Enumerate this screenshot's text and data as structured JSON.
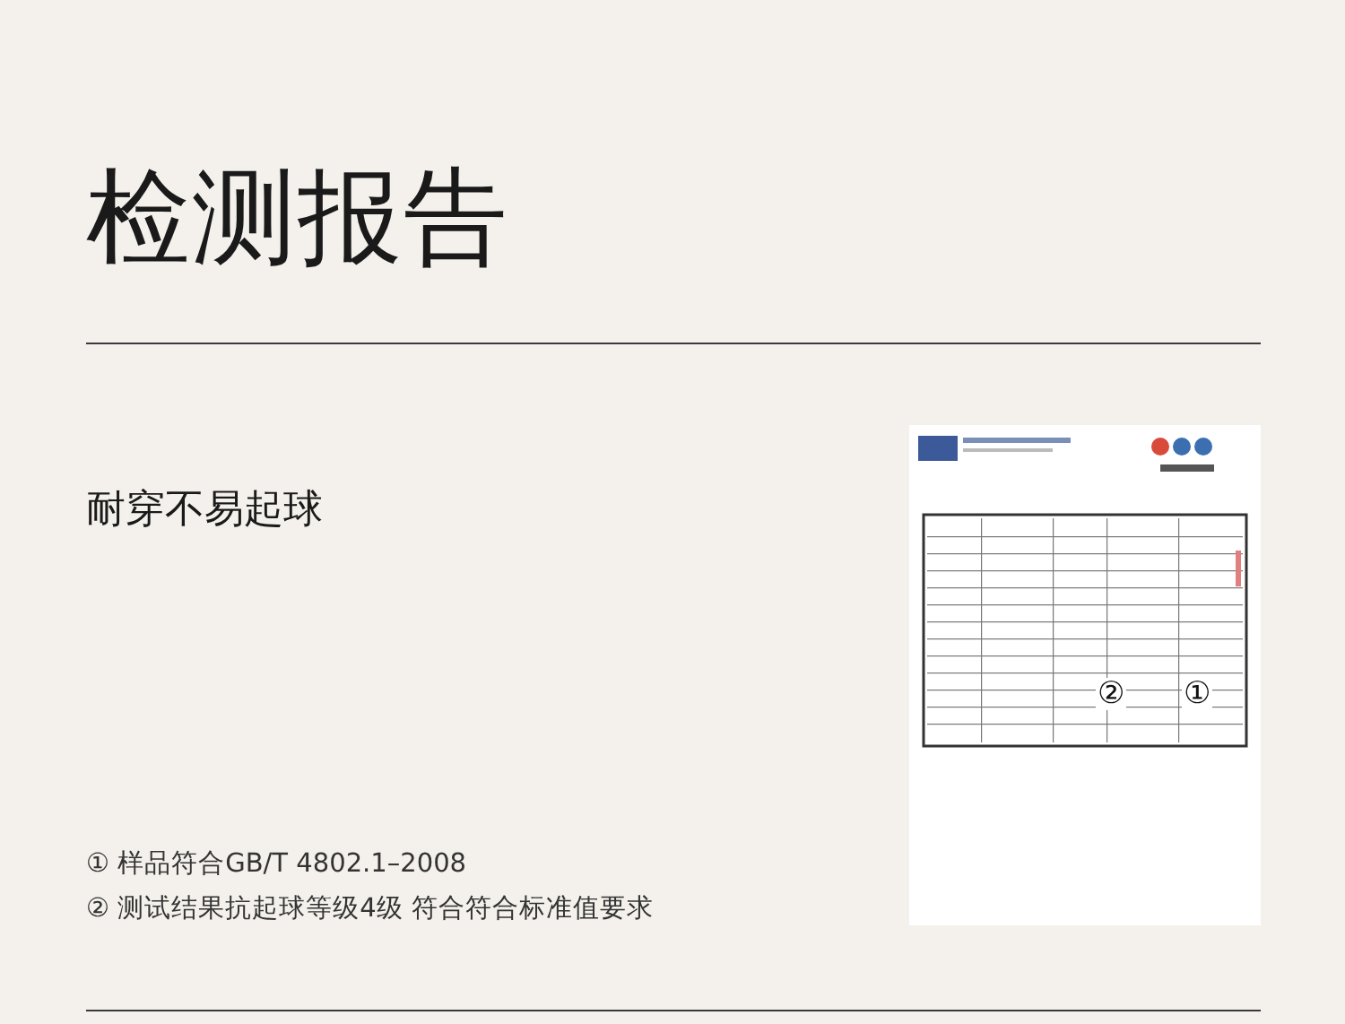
{
  "title": "检测报告",
  "subtitle": "耐穿不易起球",
  "notes": [
    "① 样品符合GB/T 4802.1–2008",
    "② 测试结果抗起球等级4级 符合符合标准值要求"
  ],
  "report": {
    "kind": "picture",
    "markers": [
      "②",
      "①"
    ]
  }
}
